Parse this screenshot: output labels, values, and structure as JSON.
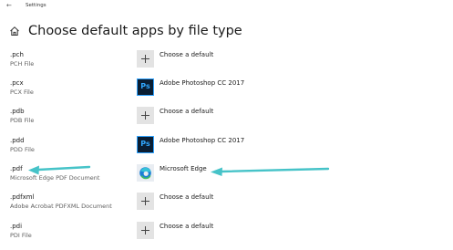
{
  "window": {
    "back_glyph": "←",
    "title": "Settings"
  },
  "page": {
    "title": "Choose default apps by file type"
  },
  "rows": [
    {
      "ext": ".pch",
      "desc": "PCH File",
      "app_label": "Choose a default",
      "icon": "plus-icon"
    },
    {
      "ext": ".pcx",
      "desc": "PCX File",
      "app_label": "Adobe Photoshop CC 2017",
      "icon": "photoshop-icon",
      "icon_text": "Ps"
    },
    {
      "ext": ".pdb",
      "desc": "PDB File",
      "app_label": "Choose a default",
      "icon": "plus-icon"
    },
    {
      "ext": ".pdd",
      "desc": "PDD File",
      "app_label": "Adobe Photoshop CC 2017",
      "icon": "photoshop-icon",
      "icon_text": "Ps"
    },
    {
      "ext": ".pdf",
      "desc": "Microsoft Edge PDF Document",
      "app_label": "Microsoft Edge",
      "icon": "edge-icon"
    },
    {
      "ext": ".pdfxml",
      "desc": "Adobe Acrobat PDFXML Document",
      "app_label": "Choose a default",
      "icon": "plus-icon"
    },
    {
      "ext": ".pdi",
      "desc": "PDI File",
      "app_label": "Choose a default",
      "icon": "plus-icon"
    }
  ],
  "colors": {
    "annotation_arrow": "#46c3c8",
    "photoshop_bg": "#0a1e33",
    "photoshop_fg": "#31a8ff"
  }
}
